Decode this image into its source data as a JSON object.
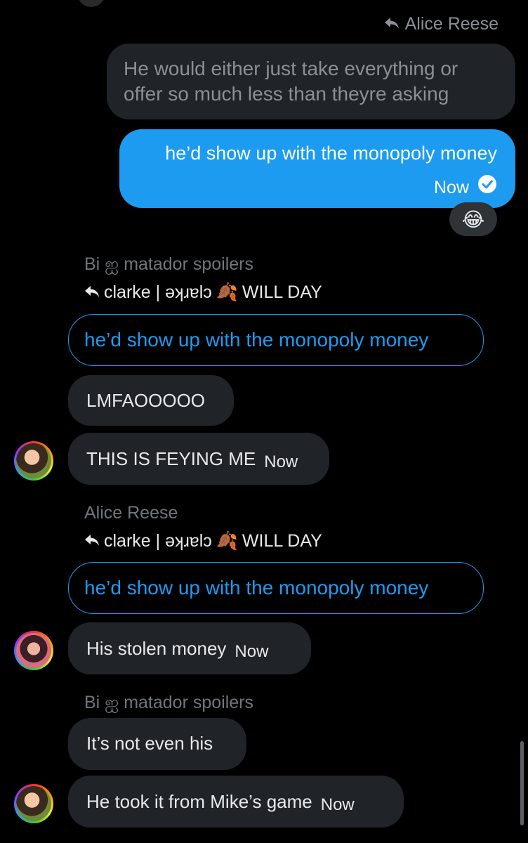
{
  "reply_top": {
    "label": "Alice Reese"
  },
  "msg_gray": {
    "line1": "He would either just take everything or",
    "line2": "offer so much less than theyre asking"
  },
  "msg_blue": {
    "text": "he’d show up with the monopoly money",
    "time": "Now"
  },
  "reaction": {
    "emoji": "😂"
  },
  "group1": {
    "name": "Bi ஐ matador spoilers",
    "reply_to": "clarke | ǝʞɹɐlɔ",
    "reply_emoji": "🍂",
    "reply_suffix": "WILL DAY",
    "quote": "he’d show up with the monopoly money",
    "msg1": "LMFAOOOOO",
    "msg2": "THIS IS FEYING ME",
    "time": "Now"
  },
  "group2": {
    "name": "Alice Reese",
    "reply_to": "clarke | ǝʞɹɐlɔ",
    "reply_emoji": "🍂",
    "reply_suffix": "WILL DAY",
    "quote": "he’d show up with the monopoly money",
    "msg1": "His stolen money",
    "time": "Now"
  },
  "group3": {
    "name": "Bi ஐ matador spoilers",
    "msg1": "It’s not even his",
    "msg2": "He took it from Mike’s game",
    "time": "Now"
  },
  "colors": {
    "accent": "#1d9bf0",
    "bubble": "#202327",
    "background": "#000000"
  },
  "icons": {
    "reply": "reply-arrow-icon",
    "sent": "check-circle-icon"
  }
}
